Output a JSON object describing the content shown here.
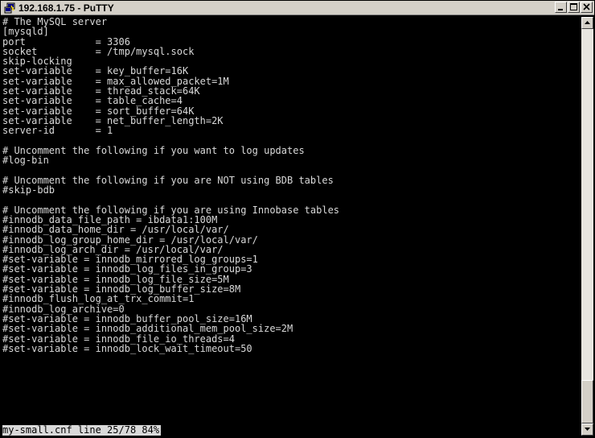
{
  "window": {
    "title": "192.168.1.75 - PuTTY",
    "app_icon": "putty-icon",
    "controls": [
      "minimize-icon",
      "maximize-icon",
      "close-icon"
    ]
  },
  "terminal": {
    "lines": [
      "# The MySQL server",
      "[mysqld]",
      "port            = 3306",
      "socket          = /tmp/mysql.sock",
      "skip-locking",
      "set-variable    = key_buffer=16K",
      "set-variable    = max_allowed_packet=1M",
      "set-variable    = thread_stack=64K",
      "set-variable    = table_cache=4",
      "set-variable    = sort_buffer=64K",
      "set-variable    = net_buffer_length=2K",
      "server-id       = 1",
      "",
      "# Uncomment the following if you want to log updates",
      "#log-bin",
      "",
      "# Uncomment the following if you are NOT using BDB tables",
      "#skip-bdb",
      "",
      "# Uncomment the following if you are using Innobase tables",
      "#innodb_data_file_path = ibdata1:100M",
      "#innodb_data_home_dir = /usr/local/var/",
      "#innodb_log_group_home_dir = /usr/local/var/",
      "#innodb_log_arch_dir = /usr/local/var/",
      "#set-variable = innodb_mirrored_log_groups=1",
      "#set-variable = innodb_log_files_in_group=3",
      "#set-variable = innodb_log_file_size=5M",
      "#set-variable = innodb_log_buffer_size=8M",
      "#innodb_flush_log_at_trx_commit=1",
      "#innodb_log_archive=0",
      "#set-variable = innodb_buffer_pool_size=16M",
      "#set-variable = innodb_additional_mem_pool_size=2M",
      "#set-variable = innodb_file_io_threads=4",
      "#set-variable = innodb_lock_wait_timeout=50"
    ],
    "status": "my-small.cnf line 25/78 84%"
  },
  "colors": {
    "terminal_bg": "#000000",
    "terminal_fg": "#d9d9d9",
    "status_bg": "#d9d9d9",
    "chrome": "#d4d0c8"
  }
}
